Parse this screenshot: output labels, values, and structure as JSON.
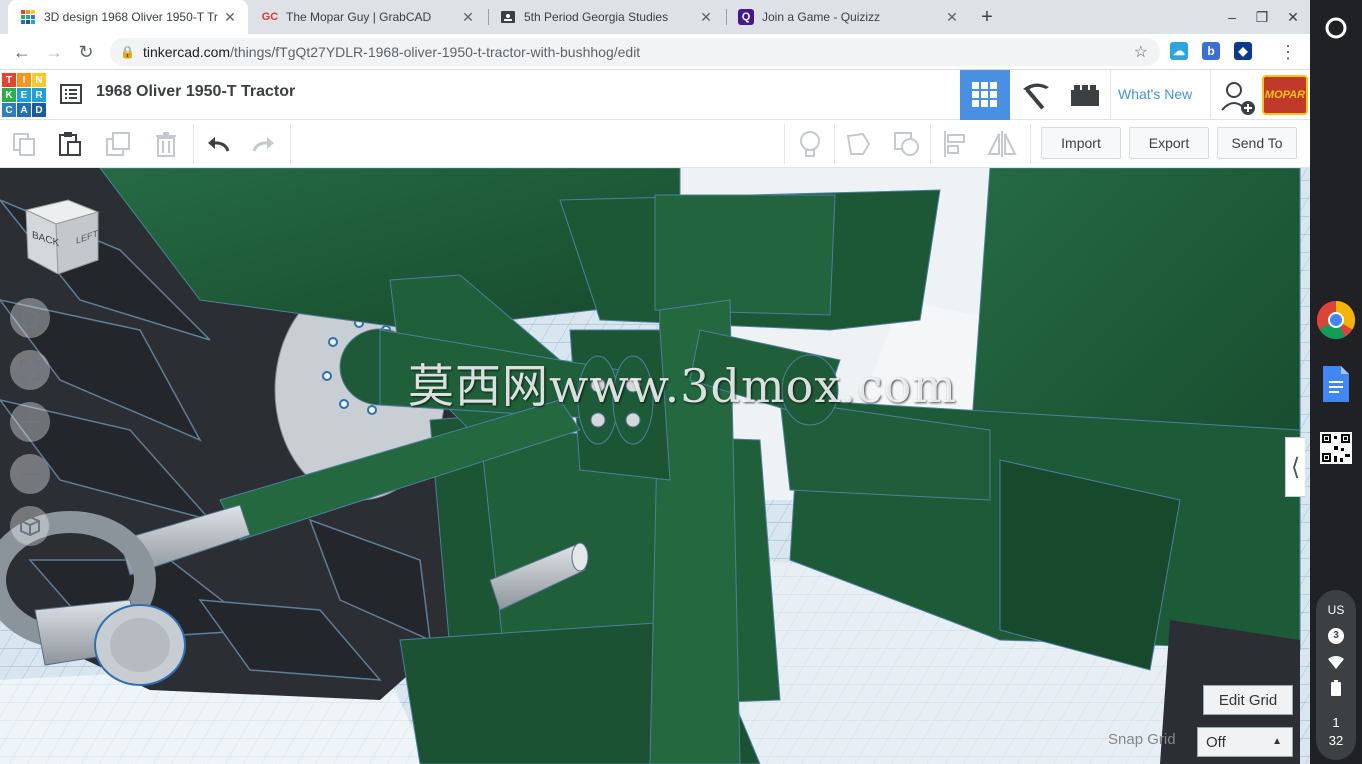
{
  "tabs": [
    {
      "title": "3D design 1968 Oliver 1950-T Tr",
      "favicon": "tinkercad-grid-icon",
      "active": true
    },
    {
      "title": "The Mopar Guy | GrabCAD",
      "favicon": "grabcad-icon",
      "favicon_text": "GC",
      "active": false
    },
    {
      "title": "5th Period Georgia Studies",
      "favicon": "classroom-icon",
      "active": false
    },
    {
      "title": "Join a Game - Quizizz",
      "favicon": "quizizz-icon",
      "favicon_text": "Q",
      "active": false
    }
  ],
  "new_tab_symbol": "+",
  "window_controls": {
    "minimize": "–",
    "restore": "❐",
    "close": "✕"
  },
  "address": {
    "host": "tinkercad.com",
    "path": "/things/fTgQt27YDLR-1968-oliver-1950-t-tractor-with-bushhog/edit"
  },
  "tinkercad_logo": [
    "T",
    "I",
    "N",
    "K",
    "E",
    "R",
    "C",
    "A",
    "D"
  ],
  "logo_colors": [
    "#e6442f",
    "#f7941d",
    "#ffc72c",
    "#2dae4a",
    "#1fa0d8",
    "#1ea1db",
    "#2e7cc4",
    "#1f6fb5",
    "#1b5aa0"
  ],
  "design_title": "1968 Oliver 1950-T Tractor",
  "nav": {
    "whats_new": "What's New",
    "avatar_text": "MOPAR"
  },
  "toolbar": {
    "import": "Import",
    "export": "Export",
    "send_to": "Send To"
  },
  "view_cube": {
    "back": "BACK",
    "left": "LEFT"
  },
  "watermark": "莫西网www.3dmox.com",
  "grid": {
    "edit_grid": "Edit Grid",
    "snap_label": "Snap Grid",
    "snap_value": "Off"
  },
  "shelf_status": {
    "keyboard": "US",
    "notifications": "3",
    "hour": "1",
    "minute": "32"
  },
  "colors": {
    "accent": "#4a90e2",
    "model_green": "#1e5a38",
    "tire": "#2b2f33"
  }
}
